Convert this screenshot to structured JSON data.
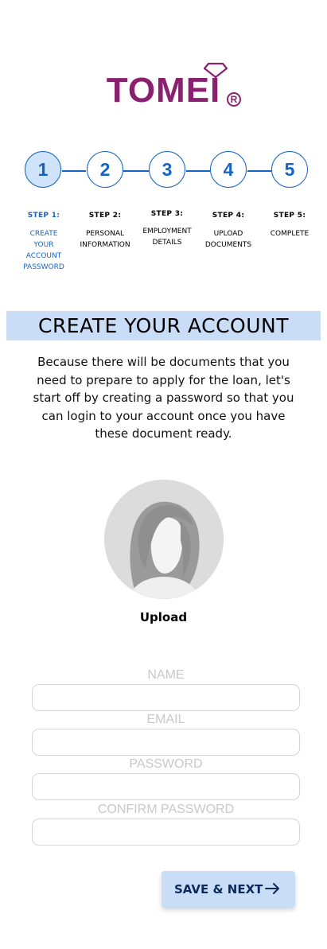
{
  "brand": {
    "name": "TOMEI",
    "registered_mark": "R",
    "color": "#8b2070"
  },
  "stepper": {
    "accent": "#1565c0",
    "steps": [
      {
        "number": "1",
        "label": "STEP 1:",
        "desc": [
          "CREATE",
          "YOUR",
          "ACCOUNT",
          "PASSWORD"
        ],
        "active": true
      },
      {
        "number": "2",
        "label": "STEP 2:",
        "desc": [
          "PERSONAL",
          "INFORMATION"
        ],
        "active": false
      },
      {
        "number": "3",
        "label": "STEP 3:",
        "desc": [
          "EMPLOYMENT",
          "DETAILS"
        ],
        "active": false
      },
      {
        "number": "4",
        "label": "STEP 4:",
        "desc": [
          "UPLOAD",
          "DOCUMENTS"
        ],
        "active": false
      },
      {
        "number": "5",
        "label": "STEP 5:",
        "desc": [
          "COMPLETE"
        ],
        "active": false
      }
    ]
  },
  "page": {
    "title": "CREATE YOUR ACCOUNT",
    "intro": "Because there will be documents that you need to prepare to apply for the loan, let's start off by creating a password so that you can login to your account once you have these document ready."
  },
  "avatar": {
    "upload_label": "Upload"
  },
  "form": {
    "name_label": "NAME",
    "name_value": "",
    "email_label": "EMAIL",
    "email_value": "",
    "password_label": "PASSWORD",
    "password_value": "",
    "confirm_label": "CONFIRM PASSWORD",
    "confirm_value": ""
  },
  "actions": {
    "save_next_label": "SAVE & NEXT",
    "arrow_icon": "arrow-right-icon"
  },
  "colors": {
    "banner_bg": "#c9ddf7",
    "button_bg": "#c9ddf7",
    "active_step_bg": "#cfe3fb"
  }
}
